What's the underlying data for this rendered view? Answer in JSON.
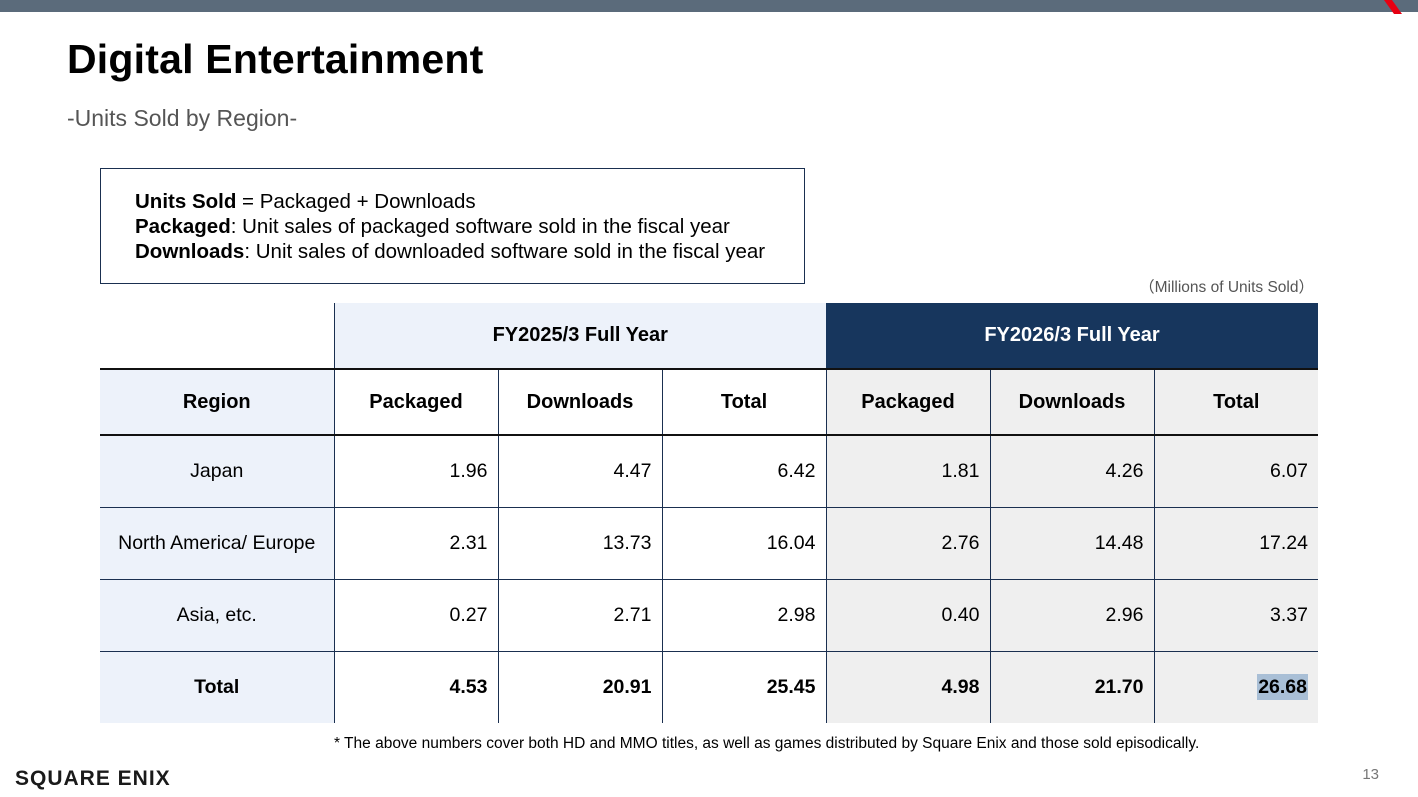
{
  "slide": {
    "title": "Digital Entertainment",
    "subtitle": "-Units Sold by Region-",
    "unit_note": "（Millions of Units Sold）",
    "footnote": "*  The above numbers cover both HD and MMO titles, as well as games distributed by Square Enix and those sold episodically.",
    "logo_text": "SQUARE ENIX",
    "page_number": "13"
  },
  "definitions": [
    {
      "term": "Units Sold",
      "text": " = Packaged + Downloads"
    },
    {
      "term": "Packaged",
      "text": ": Unit sales of packaged software sold in the fiscal year"
    },
    {
      "term": "Downloads",
      "text": ": Unit sales of downloaded software sold in the fiscal year"
    }
  ],
  "table": {
    "fy_headers": [
      "FY2025/3 Full Year",
      "FY2026/3 Full Year"
    ],
    "columns": [
      "Region",
      "Packaged",
      "Downloads",
      "Total",
      "Packaged",
      "Downloads",
      "Total"
    ],
    "rows": [
      {
        "region": "Japan",
        "values": [
          "1.96",
          "4.47",
          "6.42",
          "1.81",
          "4.26",
          "6.07"
        ]
      },
      {
        "region": "North America/ Europe",
        "values": [
          "2.31",
          "13.73",
          "16.04",
          "2.76",
          "14.48",
          "17.24"
        ]
      },
      {
        "region": "Asia, etc.",
        "values": [
          "0.27",
          "2.71",
          "2.98",
          "0.40",
          "2.96",
          "3.37"
        ]
      }
    ],
    "total_row": {
      "region": "Total",
      "values": [
        "4.53",
        "20.91",
        "25.45",
        "4.98",
        "21.70",
        "26.68"
      ]
    }
  },
  "colors": {
    "fy2026_header": "#17365d",
    "fy2025_header": "#edf2fa",
    "highlight": "#a9bfd6",
    "top_bar": "#5b6b7b",
    "accent": "#e60012"
  }
}
